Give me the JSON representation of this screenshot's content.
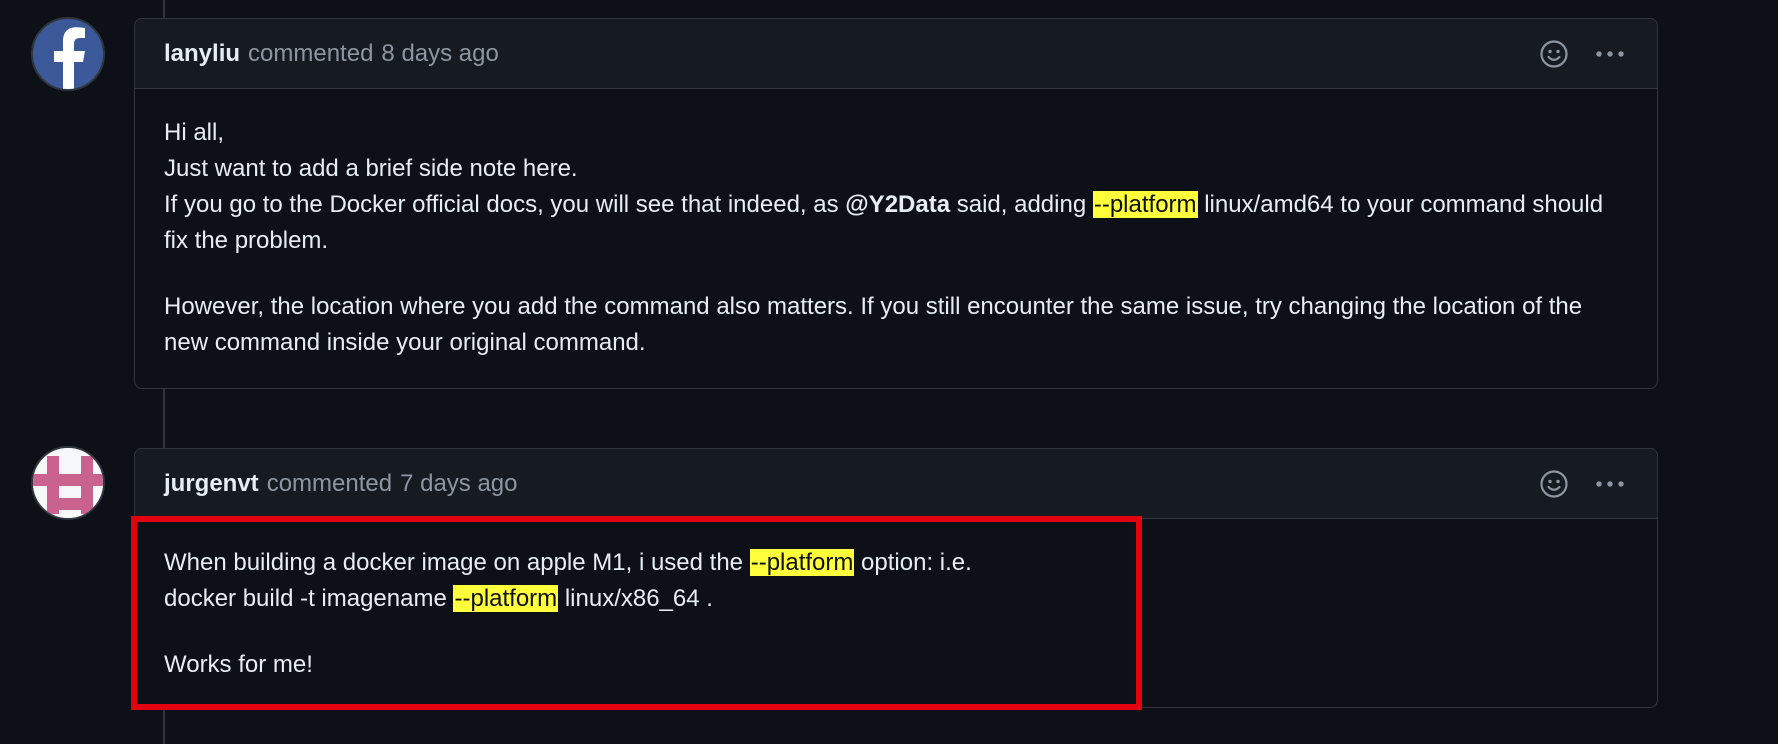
{
  "comments": [
    {
      "author": "lanyliu",
      "verb": "commented",
      "time": "8 days ago",
      "avatar_icon": "facebook-logo-icon",
      "avatar_color": "#3b5998",
      "body": {
        "p1_line1": "Hi all,",
        "p1_line2": "Just want to add a brief side note here.",
        "p1_line3_a": "If you go to the Docker official docs, you will see that indeed, as ",
        "mention": "@Y2Data",
        "p1_line3_b": " said, adding ",
        "highlight": "--platform",
        "p1_line3_c": " linux/amd64 to your command should fix the problem.",
        "p2": "However, the location where you add the command also matters. If you still encounter the same issue, try changing the location of the new command inside your original command."
      }
    },
    {
      "author": "jurgenvt",
      "verb": "commented",
      "time": "7 days ago",
      "avatar_icon": "pixel-identicon-icon",
      "avatar_color": "#c9628f",
      "body": {
        "l1_a": "When building a docker image on apple M1, i used the ",
        "highlight_1": "--platform",
        "l1_b": " option: i.e.",
        "l2_a": "docker build -t imagename ",
        "highlight_2": "--platform",
        "l2_b": " linux/x86_64 .",
        "p2": "Works for me!"
      }
    }
  ],
  "icons": {
    "reaction": "smiley-icon",
    "menu": "kebab-menu-icon"
  },
  "colors": {
    "background": "#0d1117",
    "header_bg": "#161b22",
    "border": "#30363d",
    "highlight": "#ffff3c",
    "annotation_box": "#e3000f"
  }
}
